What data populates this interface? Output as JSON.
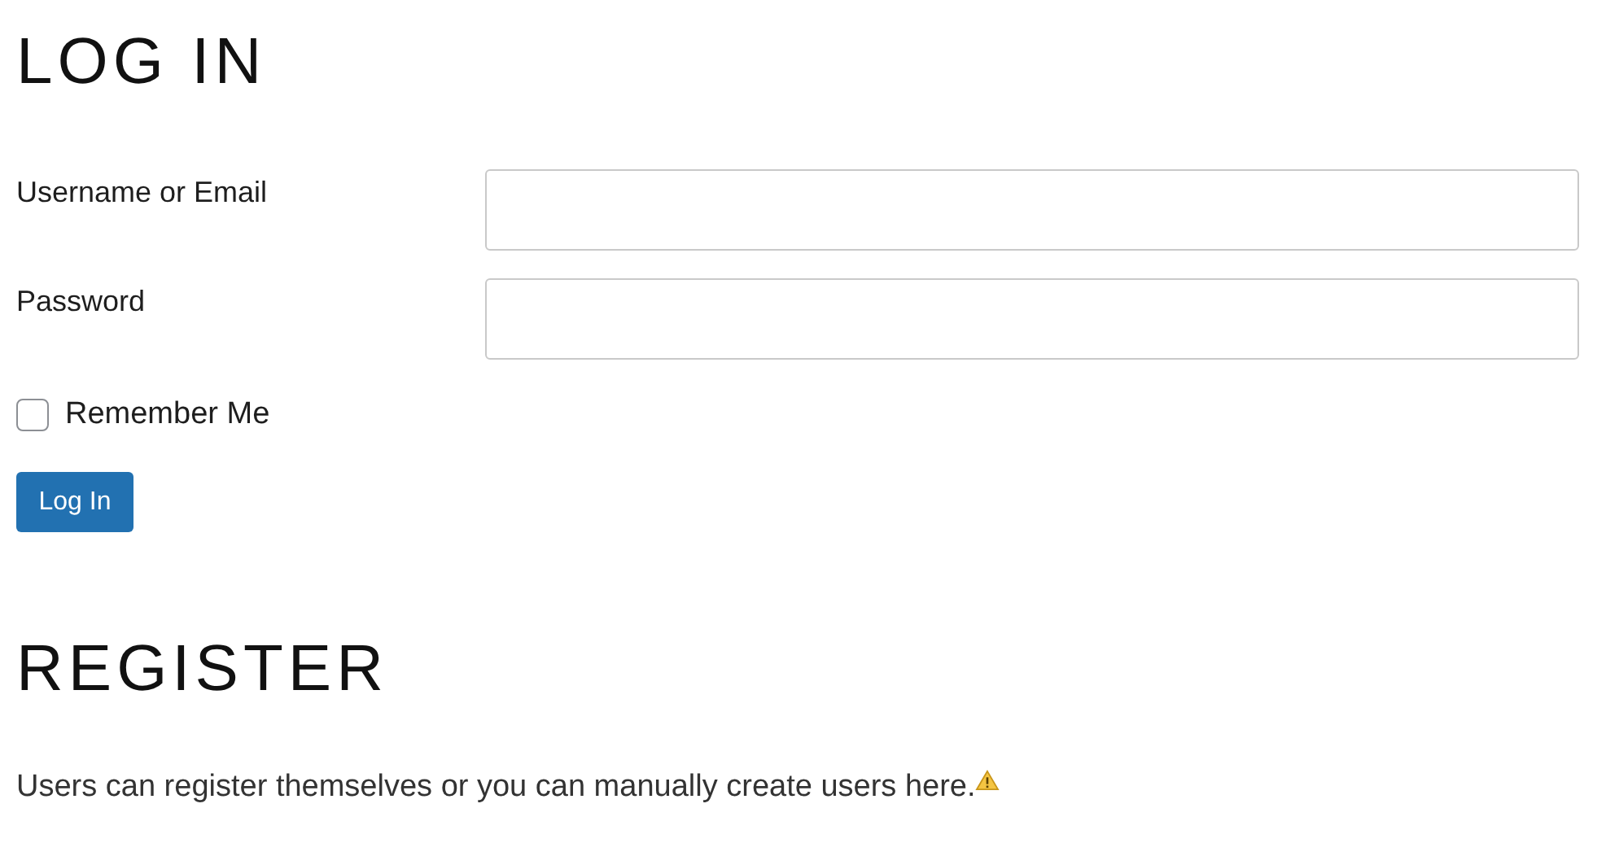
{
  "login": {
    "heading": "LOG IN",
    "fields": [
      {
        "label": "Username or Email"
      },
      {
        "label": "Password"
      }
    ],
    "remember": {
      "label": "Remember Me",
      "checked": false
    },
    "button": "Log In"
  },
  "register": {
    "heading": "REGISTER",
    "text": "Users can register themselves or you can manually create users here."
  }
}
